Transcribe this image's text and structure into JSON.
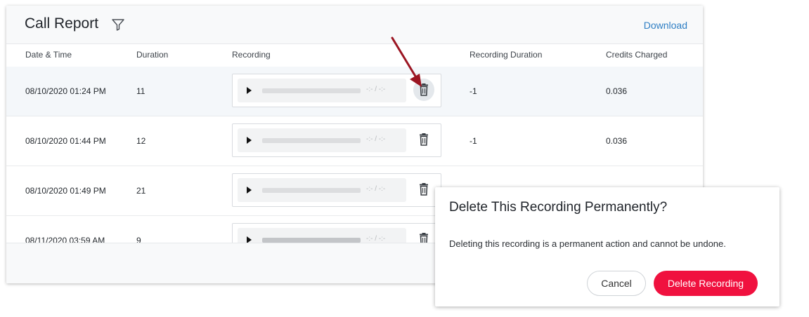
{
  "report": {
    "title": "Call Report",
    "download_label": "Download",
    "columns": {
      "datetime": "Date & Time",
      "duration": "Duration",
      "recording": "Recording",
      "recording_duration": "Recording Duration",
      "credits": "Credits Charged"
    },
    "rows": [
      {
        "datetime": "08/10/2020 01:24 PM",
        "duration": "11",
        "time": "-:- / -:-",
        "recording_duration": "-1",
        "credits": "0.036"
      },
      {
        "datetime": "08/10/2020 01:44 PM",
        "duration": "12",
        "time": "-:- / -:-",
        "recording_duration": "-1",
        "credits": "0.036"
      },
      {
        "datetime": "08/10/2020 01:49 PM",
        "duration": "21",
        "time": "-:- / -:-",
        "recording_duration": "",
        "credits": ""
      },
      {
        "datetime": "08/11/2020 03:59 AM",
        "duration": "9",
        "time": "-:- / -:-",
        "recording_duration": "",
        "credits": ""
      }
    ]
  },
  "dialog": {
    "title": "Delete This Recording Permanently?",
    "message": "Deleting this recording is a permanent action and cannot be undone.",
    "cancel_label": "Cancel",
    "delete_label": "Delete Recording"
  },
  "icons": {
    "filter": "filter-icon",
    "play": "play-icon",
    "delete": "trash-icon",
    "annotation": "arrow-icon"
  },
  "colors": {
    "link": "#2f7fc4",
    "danger": "#f0113f",
    "annotation_arrow": "#9b1522"
  }
}
